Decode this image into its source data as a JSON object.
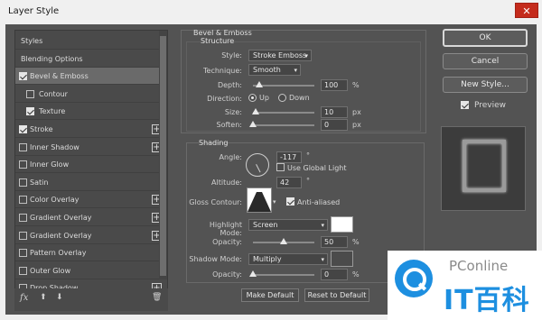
{
  "window": {
    "title": "Layer Style",
    "close_glyph": "✕"
  },
  "styles_list": {
    "items": [
      {
        "label": "Styles",
        "checkbox": false,
        "checked": false,
        "plus": false,
        "selected": false,
        "indent": 0
      },
      {
        "label": "Blending Options",
        "checkbox": false,
        "checked": false,
        "plus": false,
        "selected": false,
        "indent": 0
      },
      {
        "label": "Bevel & Emboss",
        "checkbox": true,
        "checked": true,
        "plus": false,
        "selected": true,
        "indent": 0
      },
      {
        "label": "Contour",
        "checkbox": true,
        "checked": false,
        "plus": false,
        "selected": false,
        "indent": 1
      },
      {
        "label": "Texture",
        "checkbox": true,
        "checked": true,
        "plus": false,
        "selected": false,
        "indent": 1
      },
      {
        "label": "Stroke",
        "checkbox": true,
        "checked": true,
        "plus": true,
        "selected": false,
        "indent": 0
      },
      {
        "label": "Inner Shadow",
        "checkbox": true,
        "checked": false,
        "plus": true,
        "selected": false,
        "indent": 0
      },
      {
        "label": "Inner Glow",
        "checkbox": true,
        "checked": false,
        "plus": false,
        "selected": false,
        "indent": 0
      },
      {
        "label": "Satin",
        "checkbox": true,
        "checked": false,
        "plus": false,
        "selected": false,
        "indent": 0
      },
      {
        "label": "Color Overlay",
        "checkbox": true,
        "checked": false,
        "plus": true,
        "selected": false,
        "indent": 0
      },
      {
        "label": "Gradient Overlay",
        "checkbox": true,
        "checked": false,
        "plus": true,
        "selected": false,
        "indent": 0
      },
      {
        "label": "Gradient Overlay",
        "checkbox": true,
        "checked": false,
        "plus": true,
        "selected": false,
        "indent": 0
      },
      {
        "label": "Pattern Overlay",
        "checkbox": true,
        "checked": false,
        "plus": false,
        "selected": false,
        "indent": 0
      },
      {
        "label": "Outer Glow",
        "checkbox": true,
        "checked": false,
        "plus": false,
        "selected": false,
        "indent": 0
      },
      {
        "label": "Drop Shadow",
        "checkbox": true,
        "checked": false,
        "plus": true,
        "selected": false,
        "indent": 0
      }
    ],
    "footer": {
      "fx": "fx",
      "up": "⬆",
      "down": "⬇",
      "trash": "🗑"
    }
  },
  "bevel": {
    "group_title": "Bevel & Emboss",
    "section_title": "Structure",
    "style_label": "Style:",
    "style_value": "Stroke Emboss",
    "technique_label": "Technique:",
    "technique_value": "Smooth",
    "depth_label": "Depth:",
    "depth_value": "100",
    "depth_unit": "%",
    "depth_level": 0.1,
    "direction_label": "Direction:",
    "dir_up": "Up",
    "dir_down": "Down",
    "direction_selected": "Up",
    "size_label": "Size:",
    "size_value": "10",
    "size_unit": "px",
    "size_level": 0.04,
    "soften_label": "Soften:",
    "soften_value": "0",
    "soften_unit": "px",
    "soften_level": 0
  },
  "shading": {
    "section_title": "Shading",
    "angle_label": "Angle:",
    "angle_value": "-117",
    "angle_unit": "°",
    "global_light_label": "Use Global Light",
    "global_light_checked": false,
    "altitude_label": "Altitude:",
    "altitude_value": "42",
    "altitude_unit": "°",
    "gloss_label": "Gloss Contour:",
    "anti_alias_label": "Anti-aliased",
    "anti_alias_checked": true,
    "highlight_mode_label": "Highlight Mode:",
    "highlight_mode_value": "Screen",
    "highlight_color": "#ffffff",
    "highlight_opacity_label": "Opacity:",
    "highlight_opacity_value": "50",
    "highlight_opacity_unit": "%",
    "highlight_opacity_level": 0.5,
    "shadow_mode_label": "Shadow Mode:",
    "shadow_mode_value": "Multiply",
    "shadow_color": "#4b4b4b",
    "shadow_opacity_label": "Opacity:",
    "shadow_opacity_value": "0",
    "shadow_opacity_unit": "%",
    "shadow_opacity_level": 0
  },
  "footer_buttons": {
    "make_default": "Make Default",
    "reset_default": "Reset to Default"
  },
  "actions": {
    "ok": "OK",
    "cancel": "Cancel",
    "new_style": "New Style...",
    "preview_label": "Preview",
    "preview_checked": true
  },
  "watermark": {
    "brand": "PConline",
    "sub": "IT百科"
  }
}
